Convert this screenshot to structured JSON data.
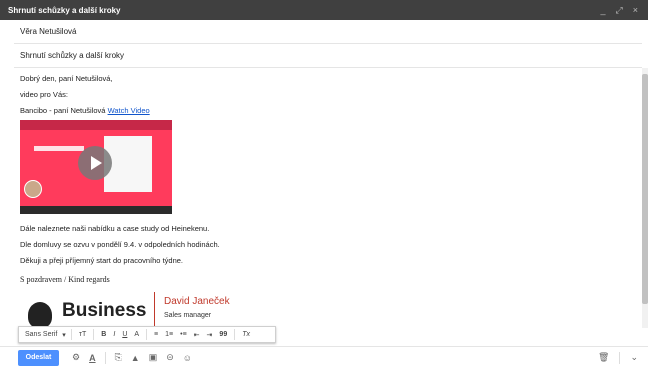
{
  "window": {
    "title": "Shrnutí schůzky a další kroky",
    "minimize": "_",
    "expand": "⤢",
    "close": "×"
  },
  "compose": {
    "recipient": "Věra Netušilová",
    "subject": "Shrnutí schůzky a další kroky"
  },
  "body": {
    "greeting": "Dobrý den, paní Netušilová,",
    "intro": "video pro Vás:",
    "video_label": "Bancibo - paní Netušilová",
    "video_link": "Watch Video",
    "line1": "Dále naleznete naši nabídku a case study od Heinekenu.",
    "line2": "Dle domluvy se ozvu v pondělí 9.4. v odpoledních hodinách.",
    "line3": "Děkuji a přeji příjemný start do pracovního týdne.",
    "closing": "S pozdravem / Kind regards"
  },
  "signature": {
    "company": "Business",
    "name": "David Janeček",
    "role": "Sales manager"
  },
  "format_toolbar": {
    "font": "Sans Serif",
    "size": "тT",
    "bold": "B",
    "italic": "I",
    "underline": "U",
    "text_color": "A",
    "align": "≡",
    "numbered": "1≡",
    "bulleted": "•≡",
    "indent_less": "⇤",
    "indent_more": "⇥",
    "quote": "99",
    "clear": "Tx"
  },
  "bottom": {
    "send": "Odeslat",
    "formatting": "A",
    "attach": "⎘",
    "drive": "▲",
    "photo": "▣",
    "link": "⊝",
    "emoji": "☺",
    "delete": "🗑",
    "more": "⌄"
  },
  "colors": {
    "send_button": "#4d90fe",
    "titlebar": "#404040",
    "link": "#1155cc",
    "signature_accent": "#c0392b"
  }
}
